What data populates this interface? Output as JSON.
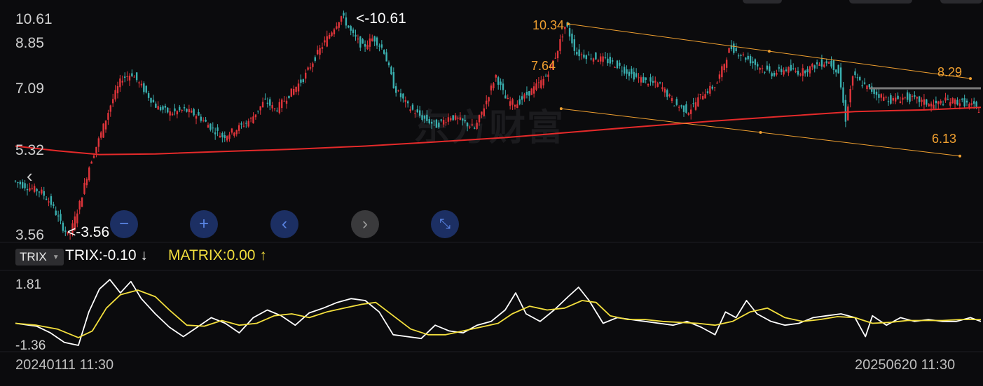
{
  "watermark": "东方财富",
  "price_axis": {
    "labels": [
      "10.61",
      "8.85",
      "7.09",
      "5.32",
      "3.56"
    ]
  },
  "annotations": {
    "high": "<-10.61",
    "low": "<-3.56",
    "channel_top": "10.34",
    "channel_bottom": "7.64",
    "right_upper": "8.29",
    "right_lower": "6.13"
  },
  "controls": {
    "zoom_out": "−",
    "zoom_in": "+",
    "prev": "‹",
    "next": "›",
    "reset": "⤡"
  },
  "indicator": {
    "name": "TRIX",
    "trix_label": "TRIX:-0.10",
    "trix_arrow": "↓",
    "matrix_label": "MATRIX:0.00",
    "matrix_arrow": "↑",
    "axis_labels": [
      "1.81",
      "-1.36"
    ]
  },
  "dates": {
    "start": "20240111 11:30",
    "end": "20250620 11:30"
  },
  "colors": {
    "up": "#e0353b",
    "down": "#3ab0b0",
    "ma_line": "#e52a2a",
    "channel": "#f0a030",
    "trix": "#ffffff",
    "matrix": "#f3df3d",
    "level_line": "#7a7a7a"
  },
  "chart_data": [
    {
      "type": "candlestick",
      "x_range": [
        "20240111 11:30",
        "20250620 11:30"
      ],
      "ylim": [
        3.56,
        10.61
      ],
      "y_ticks": [
        10.61,
        8.85,
        7.09,
        5.32,
        3.56
      ],
      "close_path": [
        [
          0,
          5.35
        ],
        [
          20,
          5.15
        ],
        [
          40,
          5.0
        ],
        [
          55,
          4.6
        ],
        [
          70,
          3.9
        ],
        [
          80,
          3.56
        ],
        [
          95,
          4.6
        ],
        [
          110,
          5.9
        ],
        [
          125,
          6.8
        ],
        [
          140,
          7.8
        ],
        [
          155,
          8.6
        ],
        [
          170,
          8.75
        ],
        [
          185,
          8.3
        ],
        [
          205,
          7.7
        ],
        [
          225,
          7.5
        ],
        [
          245,
          7.6
        ],
        [
          265,
          7.4
        ],
        [
          285,
          7.0
        ],
        [
          300,
          6.75
        ],
        [
          320,
          7.0
        ],
        [
          340,
          7.3
        ],
        [
          360,
          7.9
        ],
        [
          375,
          7.6
        ],
        [
          395,
          8.1
        ],
        [
          415,
          8.6
        ],
        [
          435,
          9.4
        ],
        [
          455,
          10.1
        ],
        [
          470,
          10.61
        ],
        [
          485,
          10.0
        ],
        [
          500,
          9.6
        ],
        [
          515,
          9.9
        ],
        [
          530,
          9.5
        ],
        [
          545,
          8.3
        ],
        [
          565,
          7.7
        ],
        [
          585,
          7.35
        ],
        [
          605,
          7.1
        ],
        [
          625,
          7.4
        ],
        [
          645,
          7.2
        ],
        [
          660,
          7.0
        ],
        [
          675,
          7.8
        ],
        [
          690,
          8.7
        ],
        [
          705,
          7.9
        ],
        [
          720,
          7.8
        ],
        [
          740,
          8.2
        ],
        [
          760,
          8.6
        ],
        [
          775,
          9.3
        ],
        [
          790,
          10.34
        ],
        [
          805,
          9.4
        ],
        [
          825,
          9.3
        ],
        [
          845,
          9.2
        ],
        [
          865,
          9.0
        ],
        [
          885,
          8.7
        ],
        [
          905,
          8.5
        ],
        [
          925,
          8.4
        ],
        [
          945,
          7.8
        ],
        [
          965,
          7.55
        ],
        [
          985,
          8.1
        ],
        [
          1005,
          8.4
        ],
        [
          1025,
          9.6
        ],
        [
          1045,
          9.3
        ],
        [
          1065,
          9.0
        ],
        [
          1085,
          8.75
        ],
        [
          1105,
          8.9
        ],
        [
          1125,
          8.8
        ],
        [
          1145,
          9.0
        ],
        [
          1165,
          9.15
        ],
        [
          1180,
          8.8
        ],
        [
          1190,
          7.3
        ],
        [
          1200,
          8.7
        ],
        [
          1215,
          8.4
        ],
        [
          1235,
          8.1
        ],
        [
          1255,
          7.9
        ],
        [
          1275,
          8.0
        ],
        [
          1295,
          7.9
        ],
        [
          1315,
          7.75
        ],
        [
          1335,
          7.9
        ],
        [
          1355,
          7.85
        ],
        [
          1375,
          7.7
        ],
        [
          1380,
          7.6
        ]
      ],
      "ma_line": [
        [
          0,
          6.45
        ],
        [
          60,
          6.3
        ],
        [
          120,
          6.18
        ],
        [
          200,
          6.2
        ],
        [
          300,
          6.28
        ],
        [
          400,
          6.35
        ],
        [
          500,
          6.45
        ],
        [
          600,
          6.58
        ],
        [
          700,
          6.72
        ],
        [
          800,
          6.9
        ],
        [
          900,
          7.08
        ],
        [
          1000,
          7.25
        ],
        [
          1100,
          7.4
        ],
        [
          1200,
          7.55
        ],
        [
          1300,
          7.6
        ],
        [
          1380,
          7.68
        ]
      ],
      "channel": {
        "upper": [
          [
            790,
            10.34
          ],
          [
            1365,
            8.6
          ]
        ],
        "lower": [
          [
            780,
            7.64
          ],
          [
            1350,
            6.13
          ]
        ]
      },
      "level_line": 8.29
    },
    {
      "type": "line",
      "indicator": "TRIX",
      "ylim": [
        -1.36,
        1.81
      ],
      "y_ticks": [
        1.81,
        -1.36
      ],
      "series": [
        {
          "name": "TRIX",
          "values": [
            [
              0,
              -0.2
            ],
            [
              30,
              -0.35
            ],
            [
              50,
              -0.7
            ],
            [
              70,
              -1.2
            ],
            [
              90,
              -1.36
            ],
            [
              105,
              0.4
            ],
            [
              120,
              1.6
            ],
            [
              135,
              2.1
            ],
            [
              150,
              1.4
            ],
            [
              165,
              2.0
            ],
            [
              180,
              1.1
            ],
            [
              200,
              0.3
            ],
            [
              220,
              -0.4
            ],
            [
              240,
              -0.9
            ],
            [
              260,
              -0.4
            ],
            [
              280,
              0.1
            ],
            [
              300,
              -0.2
            ],
            [
              320,
              -0.7
            ],
            [
              340,
              0.1
            ],
            [
              360,
              0.5
            ],
            [
              380,
              0.2
            ],
            [
              400,
              -0.3
            ],
            [
              420,
              0.35
            ],
            [
              440,
              0.6
            ],
            [
              460,
              0.9
            ],
            [
              480,
              1.1
            ],
            [
              500,
              1.0
            ],
            [
              520,
              0.4
            ],
            [
              540,
              -0.8
            ],
            [
              560,
              -0.9
            ],
            [
              580,
              -1.0
            ],
            [
              600,
              -0.3
            ],
            [
              620,
              -0.6
            ],
            [
              640,
              -0.7
            ],
            [
              660,
              -0.3
            ],
            [
              680,
              -0.1
            ],
            [
              700,
              0.5
            ],
            [
              715,
              1.4
            ],
            [
              730,
              0.3
            ],
            [
              750,
              -0.1
            ],
            [
              770,
              0.5
            ],
            [
              790,
              1.2
            ],
            [
              805,
              1.7
            ],
            [
              820,
              1.0
            ],
            [
              840,
              -0.2
            ],
            [
              860,
              0.1
            ],
            [
              880,
              0.0
            ],
            [
              900,
              -0.1
            ],
            [
              920,
              -0.2
            ],
            [
              940,
              -0.3
            ],
            [
              960,
              -0.1
            ],
            [
              980,
              -0.4
            ],
            [
              1000,
              -0.8
            ],
            [
              1015,
              0.4
            ],
            [
              1030,
              0.1
            ],
            [
              1045,
              1.0
            ],
            [
              1060,
              0.3
            ],
            [
              1080,
              -0.1
            ],
            [
              1100,
              -0.3
            ],
            [
              1120,
              -0.2
            ],
            [
              1140,
              0.1
            ],
            [
              1160,
              0.2
            ],
            [
              1180,
              0.3
            ],
            [
              1200,
              0.1
            ],
            [
              1215,
              -0.9
            ],
            [
              1225,
              0.2
            ],
            [
              1245,
              -0.3
            ],
            [
              1265,
              0.1
            ],
            [
              1285,
              -0.1
            ],
            [
              1305,
              0.0
            ],
            [
              1325,
              -0.1
            ],
            [
              1345,
              -0.1
            ],
            [
              1365,
              0.1
            ],
            [
              1380,
              -0.1
            ]
          ]
        },
        {
          "name": "MATRIX",
          "values": [
            [
              0,
              -0.2
            ],
            [
              30,
              -0.3
            ],
            [
              60,
              -0.5
            ],
            [
              90,
              -0.95
            ],
            [
              110,
              -0.6
            ],
            [
              130,
              0.6
            ],
            [
              150,
              1.3
            ],
            [
              175,
              1.55
            ],
            [
              200,
              1.2
            ],
            [
              220,
              0.5
            ],
            [
              245,
              -0.3
            ],
            [
              270,
              -0.35
            ],
            [
              295,
              -0.05
            ],
            [
              320,
              -0.3
            ],
            [
              345,
              -0.2
            ],
            [
              370,
              0.2
            ],
            [
              395,
              0.3
            ],
            [
              420,
              0.1
            ],
            [
              445,
              0.4
            ],
            [
              470,
              0.6
            ],
            [
              495,
              0.8
            ],
            [
              515,
              0.9
            ],
            [
              540,
              0.2
            ],
            [
              565,
              -0.5
            ],
            [
              590,
              -0.8
            ],
            [
              615,
              -0.8
            ],
            [
              640,
              -0.6
            ],
            [
              665,
              -0.4
            ],
            [
              690,
              -0.2
            ],
            [
              710,
              0.3
            ],
            [
              735,
              0.7
            ],
            [
              760,
              0.5
            ],
            [
              785,
              0.6
            ],
            [
              810,
              1.0
            ],
            [
              830,
              0.9
            ],
            [
              850,
              0.2
            ],
            [
              875,
              0.0
            ],
            [
              900,
              0.0
            ],
            [
              925,
              -0.1
            ],
            [
              950,
              -0.15
            ],
            [
              975,
              -0.2
            ],
            [
              1000,
              -0.3
            ],
            [
              1025,
              -0.1
            ],
            [
              1050,
              0.4
            ],
            [
              1075,
              0.6
            ],
            [
              1100,
              0.1
            ],
            [
              1125,
              -0.1
            ],
            [
              1150,
              0.0
            ],
            [
              1175,
              0.15
            ],
            [
              1200,
              0.1
            ],
            [
              1225,
              -0.2
            ],
            [
              1250,
              -0.15
            ],
            [
              1275,
              -0.05
            ],
            [
              1300,
              -0.05
            ],
            [
              1325,
              -0.05
            ],
            [
              1350,
              0.0
            ],
            [
              1375,
              0.0
            ],
            [
              1380,
              0.0
            ]
          ]
        }
      ]
    }
  ]
}
